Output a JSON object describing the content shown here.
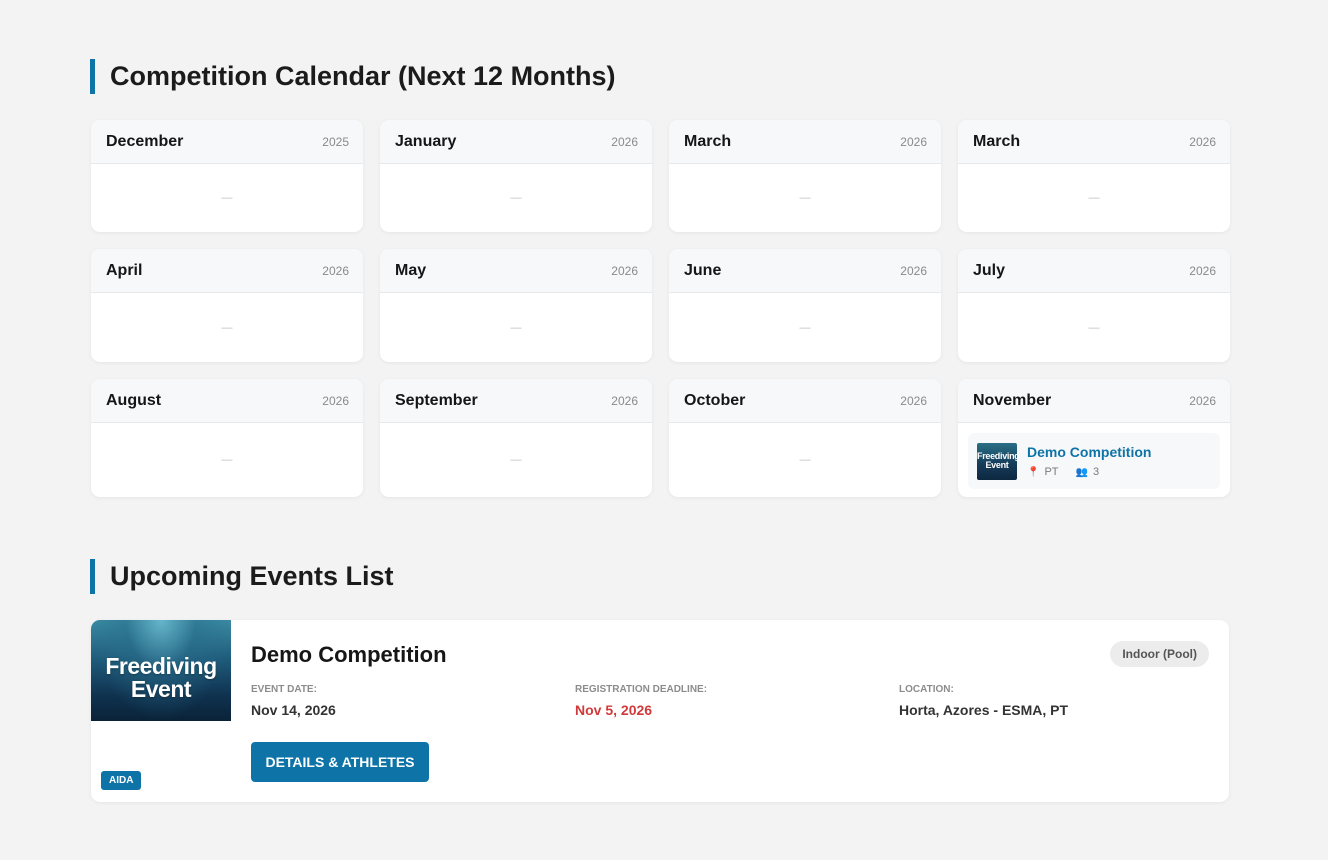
{
  "calendar": {
    "title": "Competition Calendar (Next 12 Months)",
    "empty_marker": "—",
    "months": [
      {
        "name": "December",
        "year": "2025"
      },
      {
        "name": "January",
        "year": "2026"
      },
      {
        "name": "March",
        "year": "2026"
      },
      {
        "name": "March",
        "year": "2026"
      },
      {
        "name": "April",
        "year": "2026"
      },
      {
        "name": "May",
        "year": "2026"
      },
      {
        "name": "June",
        "year": "2026"
      },
      {
        "name": "July",
        "year": "2026"
      },
      {
        "name": "August",
        "year": "2026"
      },
      {
        "name": "September",
        "year": "2026"
      },
      {
        "name": "October",
        "year": "2026"
      },
      {
        "name": "November",
        "year": "2026"
      }
    ],
    "november_event": {
      "thumb_text": "Freediving Event",
      "name": "Demo Competition",
      "country": "PT",
      "participants": "3"
    }
  },
  "events_list": {
    "title": "Upcoming Events List",
    "event": {
      "image_text": "Freediving Event",
      "organization": "AIDA",
      "name": "Demo Competition",
      "type": "Indoor (Pool)",
      "date_label": "EVENT DATE:",
      "date": "Nov 14, 2026",
      "deadline_label": "REGISTRATION DEADLINE:",
      "deadline": "Nov 5, 2026",
      "location_label": "LOCATION:",
      "location": "Horta, Azores - ESMA, PT",
      "button_label": "DETAILS & ATHLETES"
    }
  },
  "colors": {
    "accent": "#0e74a8",
    "deadline": "#d03a3a",
    "background": "#f3f3f3"
  },
  "icons": {
    "location": "map-pin-icon",
    "participants": "people-icon"
  }
}
